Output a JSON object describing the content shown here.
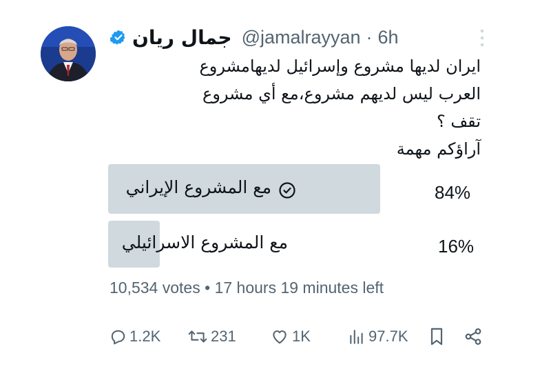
{
  "author": {
    "display_name": "جمال ريان",
    "handle": "@jamalrayyan",
    "separator": "·",
    "time": "6h"
  },
  "tweet": {
    "lines": [
      "ايران لديها مشروع وإسرائيل لديهامشروع",
      "العرب ليس لديهم مشروع،مع أي مشروع",
      "تقف ؟",
      "آراؤكم مهمة"
    ]
  },
  "poll": {
    "options": [
      {
        "label": "مع المشروع الإيراني",
        "percent": 84,
        "percent_label": "84%",
        "selected": true
      },
      {
        "label": "مع المشروع الاسرائيلي",
        "percent": 16,
        "percent_label": "16%",
        "selected": false
      }
    ],
    "votes": "10,534 votes",
    "separator": "•",
    "time_left": "17 hours 19 minutes left"
  },
  "actions": {
    "replies": "1.2K",
    "retweets": "231",
    "likes": "1K",
    "views": "97.7K"
  },
  "colors": {
    "verified": "#1d9bf0",
    "poll_bar": "#cfd9de",
    "secondary_text": "#536471",
    "primary_text": "#0f1419"
  }
}
